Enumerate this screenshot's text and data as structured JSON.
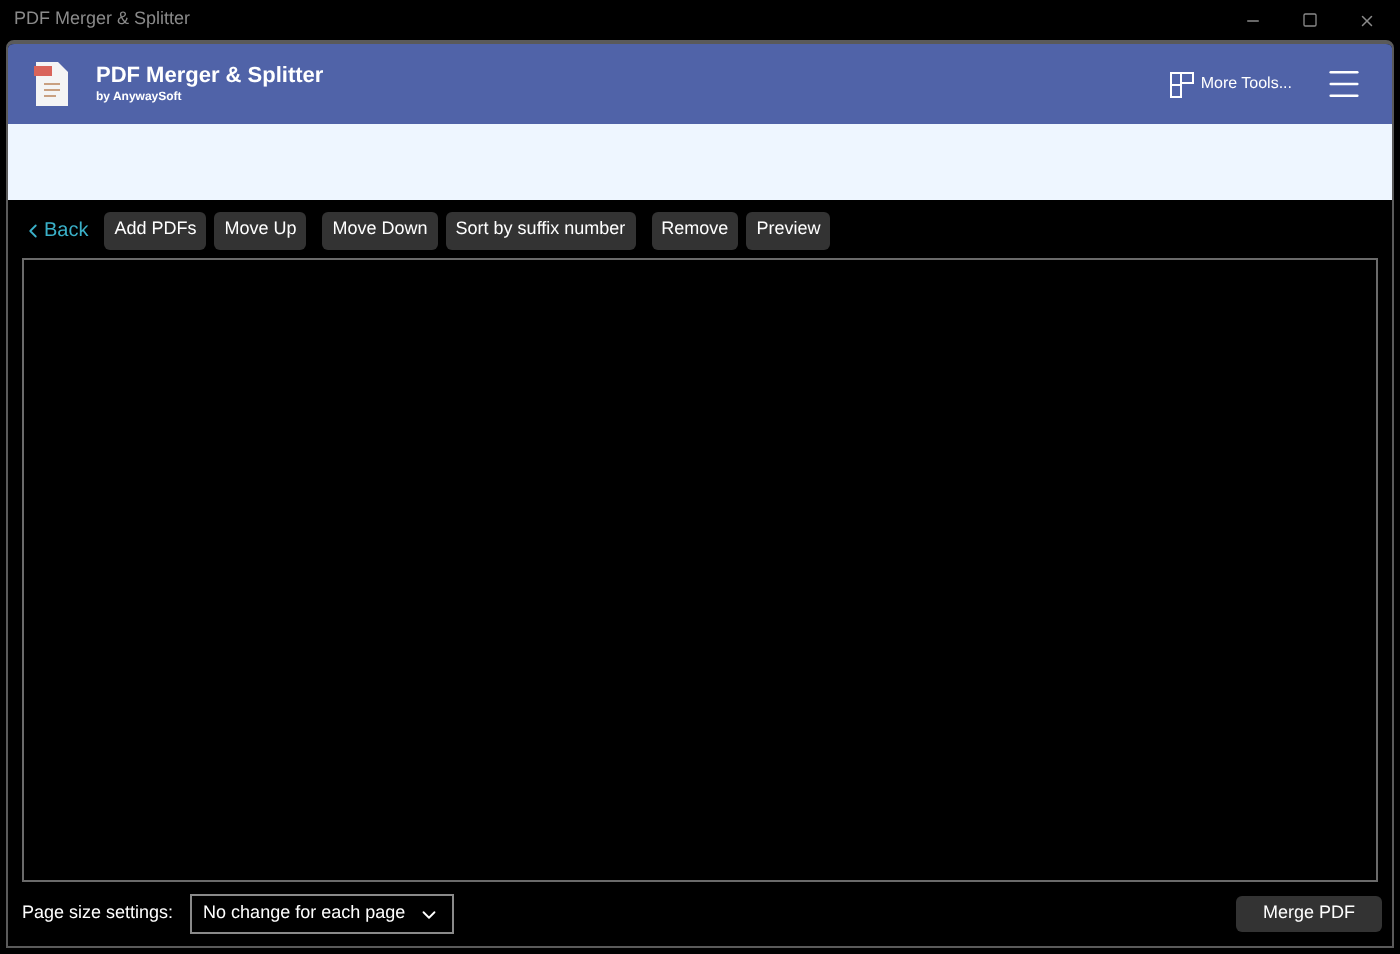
{
  "window": {
    "title": "PDF Merger & Splitter"
  },
  "header": {
    "app_name": "PDF Merger & Splitter",
    "publisher": "by AnywaySoft",
    "more_tools": "More Tools..."
  },
  "toolbar": {
    "back": "Back",
    "buttons": [
      "Add PDFs",
      "Move Up",
      "Move Down",
      "Sort by suffix number",
      "Remove",
      "Preview"
    ]
  },
  "footer": {
    "page_size_label": "Page size settings:",
    "page_size_value": "No change for each page",
    "merge_button": "Merge PDF"
  }
}
